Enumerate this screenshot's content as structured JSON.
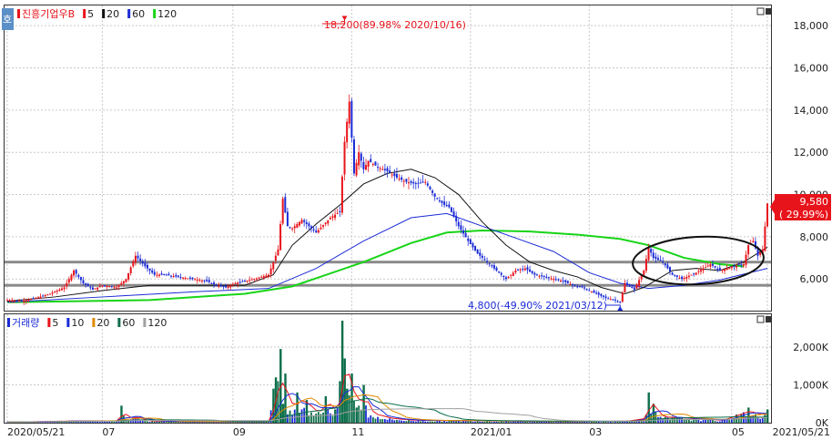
{
  "colors": {
    "up": "#e8141b",
    "down": "#1a2bd6",
    "ma5": "#e8141b",
    "ma20": "#111111",
    "ma60": "#1a2bd6",
    "ma120": "#18d418",
    "vol20": "#e08a00",
    "vol60": "#0c6e4a",
    "vol120": "#a0a0a0",
    "grid": "#c9c9c9",
    "panelbg": "#ffffff",
    "ellipse": "#111111"
  },
  "header": {
    "code_badge": "호",
    "price_legend": [
      {
        "label": "진흥기업우B",
        "color": "#e8141b"
      },
      {
        "label": "5",
        "color": "#e8141b"
      },
      {
        "label": "20",
        "color": "#111111"
      },
      {
        "label": "60",
        "color": "#1a2bd6"
      },
      {
        "label": "120",
        "color": "#18d418"
      }
    ],
    "volume_legend": [
      {
        "label": "거래량",
        "color": "#1a2bd6"
      },
      {
        "label": "5",
        "color": "#e8141b"
      },
      {
        "label": "10",
        "color": "#1a2bd6"
      },
      {
        "label": "20",
        "color": "#e08a00"
      },
      {
        "label": "60",
        "color": "#0c6e4a"
      },
      {
        "label": "120",
        "color": "#a0a0a0"
      }
    ]
  },
  "annotations": {
    "high": "18,200(89.98% 2020/10/16)",
    "low": "4,800(-49.90% 2021/03/12)",
    "last_price": "9,580",
    "last_change": "( 29.99%)"
  },
  "chart_data": [
    {
      "type": "candlestick",
      "title": "진흥기업우B",
      "y_ticks": [
        "6,000",
        "8,000",
        "10,000",
        "12,000",
        "14,000",
        "16,000",
        "18,000"
      ],
      "y_tick_values": [
        6000,
        8000,
        10000,
        12000,
        14000,
        16000,
        18000
      ],
      "ylim": [
        4500,
        19000
      ],
      "x_ticks": [
        "2020/05/21",
        "07",
        "09",
        "11",
        "2021/01",
        "03",
        "05",
        "2021/05/21"
      ],
      "grid": true,
      "moving_averages": [
        "5",
        "20",
        "60",
        "120"
      ],
      "horizontal_levels": [
        6800,
        5700
      ],
      "close_path": [
        [
          0,
          5000
        ],
        [
          6,
          4950
        ],
        [
          12,
          5100
        ],
        [
          18,
          5300
        ],
        [
          24,
          5600
        ],
        [
          28,
          6400
        ],
        [
          32,
          5800
        ],
        [
          36,
          5500
        ],
        [
          40,
          5700
        ],
        [
          46,
          5600
        ],
        [
          50,
          6000
        ],
        [
          54,
          7100
        ],
        [
          58,
          6600
        ],
        [
          62,
          6200
        ],
        [
          66,
          6200
        ],
        [
          72,
          6100
        ],
        [
          78,
          6000
        ],
        [
          84,
          5900
        ],
        [
          88,
          5700
        ],
        [
          92,
          5600
        ],
        [
          96,
          5800
        ],
        [
          104,
          6000
        ],
        [
          110,
          6200
        ],
        [
          114,
          7400
        ],
        [
          116,
          9800
        ],
        [
          118,
          8500
        ],
        [
          120,
          8400
        ],
        [
          124,
          8800
        ],
        [
          130,
          8200
        ],
        [
          136,
          8900
        ],
        [
          140,
          9200
        ],
        [
          142,
          12500
        ],
        [
          144,
          14400
        ],
        [
          146,
          11000
        ],
        [
          148,
          12000
        ],
        [
          150,
          11200
        ],
        [
          152,
          11600
        ],
        [
          156,
          11300
        ],
        [
          160,
          11100
        ],
        [
          164,
          10800
        ],
        [
          168,
          10600
        ],
        [
          172,
          10500
        ],
        [
          176,
          10600
        ],
        [
          180,
          9900
        ],
        [
          184,
          9500
        ],
        [
          186,
          9400
        ],
        [
          190,
          8500
        ],
        [
          194,
          7800
        ],
        [
          198,
          7200
        ],
        [
          202,
          6800
        ],
        [
          206,
          6400
        ],
        [
          210,
          6000
        ],
        [
          214,
          6400
        ],
        [
          218,
          6500
        ],
        [
          222,
          6200
        ],
        [
          226,
          6100
        ],
        [
          230,
          6000
        ],
        [
          234,
          5900
        ],
        [
          238,
          5700
        ],
        [
          242,
          5600
        ],
        [
          246,
          5400
        ],
        [
          250,
          5200
        ],
        [
          252,
          5100
        ],
        [
          256,
          5000
        ],
        [
          258,
          4900
        ],
        [
          260,
          5800
        ],
        [
          264,
          5500
        ],
        [
          268,
          6400
        ],
        [
          270,
          7500
        ],
        [
          272,
          7000
        ],
        [
          276,
          6800
        ],
        [
          280,
          6200
        ],
        [
          284,
          6000
        ],
        [
          290,
          6300
        ],
        [
          296,
          6700
        ],
        [
          300,
          6400
        ],
        [
          306,
          6600
        ],
        [
          310,
          6700
        ],
        [
          312,
          7600
        ],
        [
          314,
          7800
        ],
        [
          316,
          7100
        ],
        [
          318,
          7400
        ],
        [
          320,
          9580
        ]
      ],
      "ma20_path": [
        [
          0,
          4950
        ],
        [
          20,
          5150
        ],
        [
          40,
          5450
        ],
        [
          60,
          5700
        ],
        [
          80,
          5700
        ],
        [
          100,
          5700
        ],
        [
          112,
          6200
        ],
        [
          120,
          7600
        ],
        [
          130,
          8600
        ],
        [
          140,
          9500
        ],
        [
          150,
          10500
        ],
        [
          160,
          11000
        ],
        [
          170,
          11200
        ],
        [
          180,
          10800
        ],
        [
          190,
          10000
        ],
        [
          200,
          8700
        ],
        [
          210,
          7600
        ],
        [
          220,
          6800
        ],
        [
          230,
          6400
        ],
        [
          240,
          6100
        ],
        [
          250,
          5600
        ],
        [
          260,
          5300
        ],
        [
          268,
          5600
        ],
        [
          280,
          6400
        ],
        [
          290,
          6500
        ],
        [
          300,
          6400
        ],
        [
          310,
          6800
        ],
        [
          320,
          7500
        ]
      ],
      "ma60_path": [
        [
          0,
          4900
        ],
        [
          40,
          5150
        ],
        [
          80,
          5400
        ],
        [
          110,
          5550
        ],
        [
          130,
          6500
        ],
        [
          150,
          7800
        ],
        [
          170,
          8900
        ],
        [
          185,
          9100
        ],
        [
          200,
          8500
        ],
        [
          215,
          7900
        ],
        [
          230,
          7300
        ],
        [
          245,
          6300
        ],
        [
          258,
          5800
        ],
        [
          270,
          5550
        ],
        [
          285,
          5700
        ],
        [
          300,
          5950
        ],
        [
          320,
          6500
        ]
      ],
      "ma120_path": [
        [
          0,
          4900
        ],
        [
          60,
          5000
        ],
        [
          100,
          5300
        ],
        [
          120,
          5650
        ],
        [
          150,
          6800
        ],
        [
          170,
          7700
        ],
        [
          185,
          8200
        ],
        [
          200,
          8300
        ],
        [
          220,
          8250
        ],
        [
          240,
          8100
        ],
        [
          258,
          7900
        ],
        [
          270,
          7600
        ],
        [
          285,
          7000
        ],
        [
          300,
          6700
        ],
        [
          310,
          6600
        ]
      ],
      "peak_marker": {
        "x": 142,
        "price": 18200
      },
      "low_marker": {
        "x": 258,
        "price": 4800
      }
    },
    {
      "type": "bar",
      "title": "거래량",
      "y_ticks": [
        "0K",
        "1,000K",
        "2,000K"
      ],
      "y_tick_values": [
        0,
        1000,
        2000
      ],
      "ylim": [
        0,
        2700
      ],
      "spikes": [
        [
          0,
          20
        ],
        [
          30,
          60
        ],
        [
          46,
          60
        ],
        [
          48,
          450
        ],
        [
          50,
          120
        ],
        [
          54,
          200
        ],
        [
          58,
          60
        ],
        [
          70,
          40
        ],
        [
          90,
          30
        ],
        [
          110,
          50
        ],
        [
          112,
          900
        ],
        [
          113,
          1200
        ],
        [
          115,
          1950
        ],
        [
          116,
          500
        ],
        [
          117,
          1300
        ],
        [
          118,
          300
        ],
        [
          122,
          800
        ],
        [
          126,
          600
        ],
        [
          130,
          300
        ],
        [
          134,
          700
        ],
        [
          138,
          350
        ],
        [
          140,
          1100
        ],
        [
          141,
          2700
        ],
        [
          142,
          1700
        ],
        [
          143,
          900
        ],
        [
          145,
          1300
        ],
        [
          147,
          400
        ],
        [
          150,
          1000
        ],
        [
          152,
          300
        ],
        [
          156,
          250
        ],
        [
          160,
          150
        ],
        [
          170,
          80
        ],
        [
          200,
          60
        ],
        [
          230,
          40
        ],
        [
          260,
          50
        ],
        [
          268,
          150
        ],
        [
          270,
          800
        ],
        [
          272,
          500
        ],
        [
          274,
          200
        ],
        [
          300,
          80
        ],
        [
          312,
          400
        ],
        [
          314,
          300
        ],
        [
          318,
          250
        ],
        [
          320,
          350
        ]
      ]
    }
  ]
}
